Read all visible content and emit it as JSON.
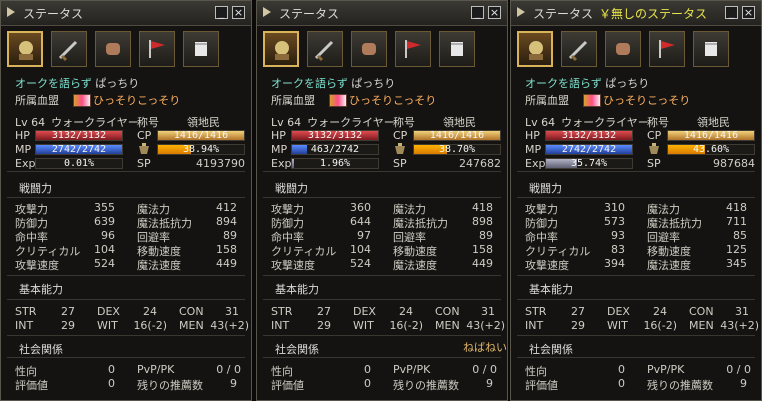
{
  "common": {
    "title": "ステータス",
    "labels": {
      "hp": "HP",
      "mp": "MP",
      "exp": "Exp",
      "cp": "CP",
      "sp": "SP",
      "battle": "戦闘力",
      "patk": "攻撃力",
      "pdef": "防御力",
      "acc": "命中率",
      "crit": "クリティカル",
      "aspd": "攻撃速度",
      "matk": "魔法力",
      "mdef": "魔法抵抗力",
      "eva": "回避率",
      "speed": "移動速度",
      "cspd": "魔法速度",
      "basic": "基本能力",
      "str": "STR",
      "dex": "DEX",
      "con": "CON",
      "int": "INT",
      "wit": "WIT",
      "men": "MEN",
      "social": "社会関係",
      "karma": "性向",
      "rating": "評価値",
      "pvp": "PvP/PK",
      "rec": "残りの推薦数",
      "rank_header": "称号",
      "rank": "領地民"
    },
    "name": "オークを語らず",
    "name_suffix": "ぱっちり",
    "clan_label": "所属血盟",
    "clan": "ひっそりこっそり",
    "level": "Lv 64",
    "class": "ウォークライヤー"
  },
  "panels": [
    {
      "title_extra": "",
      "hp": "3132/3132",
      "mp": "2742/2742",
      "exp": "0.01%",
      "cp": "1416/1416",
      "weight": "38.94%",
      "sp": "4193790",
      "hp_pct": 100,
      "mp_pct": 100,
      "exp_pct": 0.01,
      "cp_pct": 100,
      "weight_pct": 38.94,
      "patk": "355",
      "pdef": "639",
      "acc": "96",
      "crit": "104",
      "aspd": "524",
      "matk": "412",
      "mdef": "894",
      "eva": "89",
      "speed": "158",
      "cspd": "449",
      "str": "27",
      "dex": "24",
      "con": "31",
      "int": "29",
      "wit": "16(-2)",
      "men": "43(+2)",
      "karma": "0",
      "rating": "0",
      "pvp": "0 / 0",
      "rec": "9",
      "overlay": ""
    },
    {
      "title_extra": "",
      "hp": "3132/3132",
      "mp": "463/2742",
      "exp": "1.96%",
      "cp": "1416/1416",
      "weight": "38.70%",
      "sp": "247682",
      "hp_pct": 100,
      "mp_pct": 16.9,
      "exp_pct": 1.96,
      "cp_pct": 100,
      "weight_pct": 38.7,
      "patk": "360",
      "pdef": "644",
      "acc": "97",
      "crit": "104",
      "aspd": "524",
      "matk": "418",
      "mdef": "898",
      "eva": "89",
      "speed": "158",
      "cspd": "449",
      "str": "27",
      "dex": "24",
      "con": "31",
      "int": "29",
      "wit": "16(-2)",
      "men": "43(+2)",
      "karma": "0",
      "rating": "0",
      "pvp": "0 / 0",
      "rec": "9",
      "overlay": "ねばねい"
    },
    {
      "title_extra": "￥無しのステータス",
      "hp": "3132/3132",
      "mp": "2742/2742",
      "exp": "35.74%",
      "cp": "1416/1416",
      "weight": "43.60%",
      "sp": "987684",
      "hp_pct": 100,
      "mp_pct": 100,
      "exp_pct": 35.74,
      "cp_pct": 100,
      "weight_pct": 43.6,
      "patk": "310",
      "pdef": "573",
      "acc": "93",
      "crit": "83",
      "aspd": "394",
      "matk": "418",
      "mdef": "711",
      "eva": "85",
      "speed": "125",
      "cspd": "345",
      "str": "27",
      "dex": "24",
      "con": "31",
      "int": "29",
      "wit": "16(-2)",
      "men": "43(+2)",
      "karma": "0",
      "rating": "0",
      "pvp": "0 / 0",
      "rec": "9",
      "overlay": ""
    }
  ],
  "icons": [
    "status-tab-icon",
    "weapon-tab-icon",
    "fist-tab-icon",
    "flag-tab-icon",
    "scroll-tab-icon"
  ]
}
